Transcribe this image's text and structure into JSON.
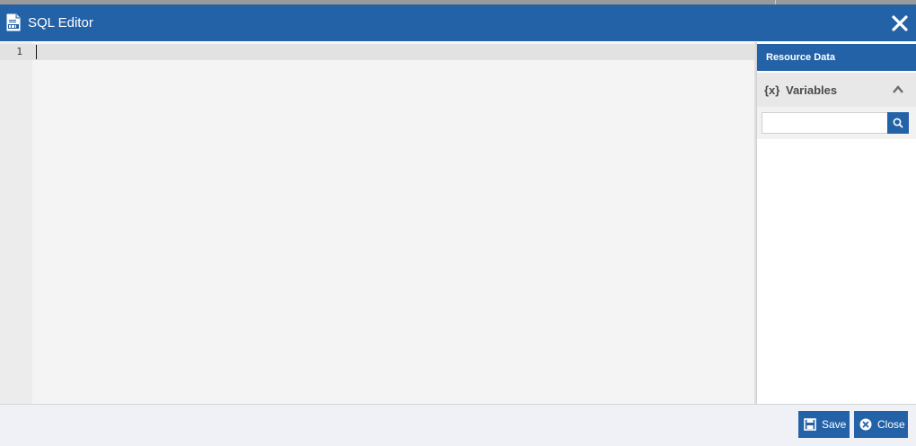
{
  "window": {
    "title": "SQL Editor"
  },
  "editor": {
    "line_numbers": [
      "1"
    ]
  },
  "resource_panel": {
    "header": "Resource Data",
    "variables_icon_text": "{x}",
    "variables_label": "Variables",
    "search": {
      "value": "",
      "placeholder": ""
    }
  },
  "footer": {
    "save_label": "Save",
    "close_label": "Close"
  },
  "colors": {
    "accent": "#2462a8",
    "editor_bg": "#f4f4f4",
    "footer_bg": "#eff1f6"
  },
  "icons": {
    "title": "sql-document-icon",
    "close": "close-icon",
    "collapse": "chevron-up-icon",
    "search": "search-icon",
    "save": "floppy-disk-icon",
    "close_button": "close-circle-icon"
  }
}
